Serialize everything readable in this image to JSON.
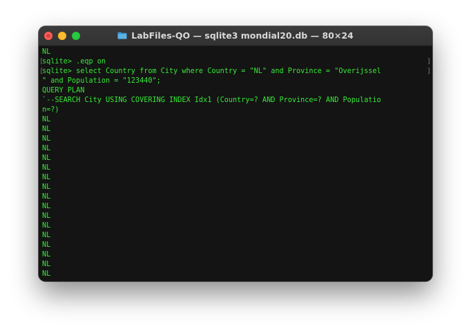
{
  "window": {
    "title": "LabFiles-QO — sqlite3 mondial20.db — 80×24",
    "folder_icon": "folder-icon"
  },
  "colors": {
    "terminal_bg": "#141414",
    "terminal_text": "#38e838",
    "close": "#fe5f57",
    "minimize": "#febc2e",
    "zoom": "#28c840",
    "folder": "#4ea3d8"
  },
  "terminal": {
    "lines": [
      "NL",
      "sqlite> .eqp on",
      "sqlite> select Country from City where Country = \"NL\" and Province = \"Overijssel",
      "\" and Population = \"123440\";",
      "QUERY PLAN",
      "`--SEARCH City USING COVERING INDEX Idx1 (Country=? AND Province=? AND Populatio",
      "n=?)",
      "NL",
      "NL",
      "NL",
      "NL",
      "NL",
      "NL",
      "NL",
      "NL",
      "NL",
      "NL",
      "NL",
      "NL",
      "NL",
      "NL",
      "NL",
      "NL",
      "NL"
    ]
  }
}
